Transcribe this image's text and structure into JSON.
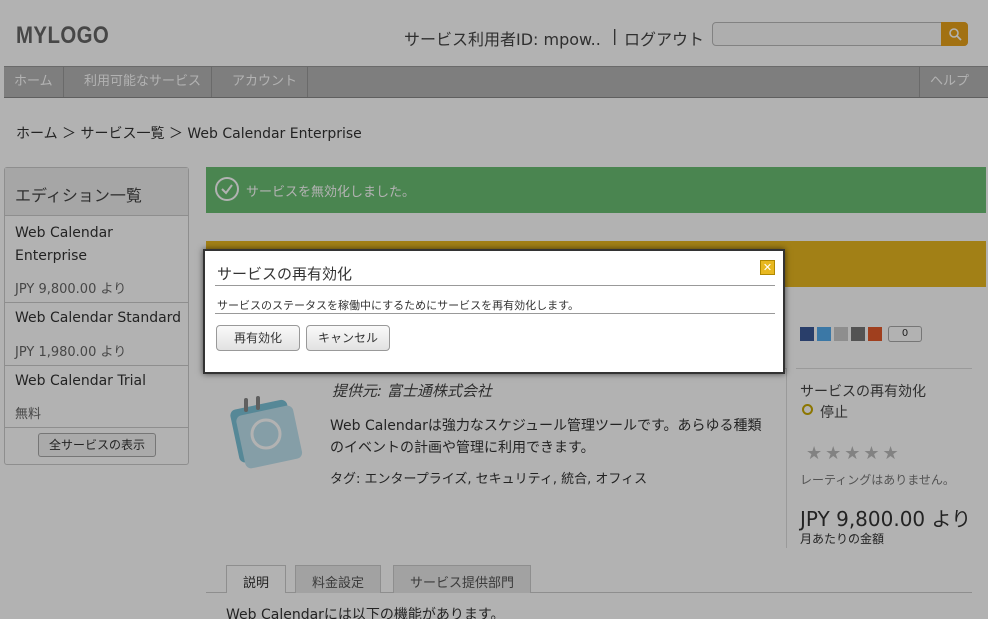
{
  "header": {
    "logo": "MYLOGO",
    "user_id": "サービス利用者ID: mpow..",
    "separator": "|",
    "logout": "ログアウト",
    "search_placeholder": ""
  },
  "nav": {
    "items": [
      "ホーム",
      "利用可能なサービス",
      "アカウント"
    ],
    "help": "ヘルプ"
  },
  "breadcrumb": "ホーム ＞ サービス一覧 ＞ Web Calendar Enterprise",
  "sidebar": {
    "title": "エディション一覧",
    "editions": [
      {
        "name1": "Web Calendar",
        "name2": "Enterprise",
        "price": "JPY 9,800.00 より"
      },
      {
        "name1": "Web Calendar Standard",
        "price": "JPY 1,980.00 より"
      },
      {
        "name1": "Web Calendar Trial",
        "price": "無料"
      }
    ],
    "show_all": "全サービスの表示"
  },
  "main": {
    "success_message": "サービスを無効化しました。",
    "provider": "提供元: 富士通株式会社",
    "description": "Web Calendarは強力なスケジュール管理ツールです。あらゆる種類のイベントの計画や管理に利用できます。",
    "tags": "タグ: エンタープライズ, セキュリティ, 統合, オフィス",
    "share_count": "0",
    "tabs": [
      "説明",
      "料金設定",
      "サービス提供部門"
    ],
    "body_text": "Web Calendarには以下の機能があります。"
  },
  "right_panel": {
    "reactivate_link": "サービスの再有効化",
    "status": "停止",
    "stars": "★★★★★",
    "rating_text": "レーティングはありません。",
    "price": "JPY 9,800.00 より",
    "monthly": "月あたりの金額"
  },
  "dialog": {
    "title": "サービスの再有効化",
    "message": "サービスのステータスを稼働中にするためにサービスを再有効化します。",
    "reactivate_button": "再有効化",
    "cancel_button": "キャンセル",
    "close_glyph": "✕"
  },
  "colors": {
    "success": "#6bbf73",
    "warning": "#e8b820",
    "accent": "#e8a21a"
  }
}
